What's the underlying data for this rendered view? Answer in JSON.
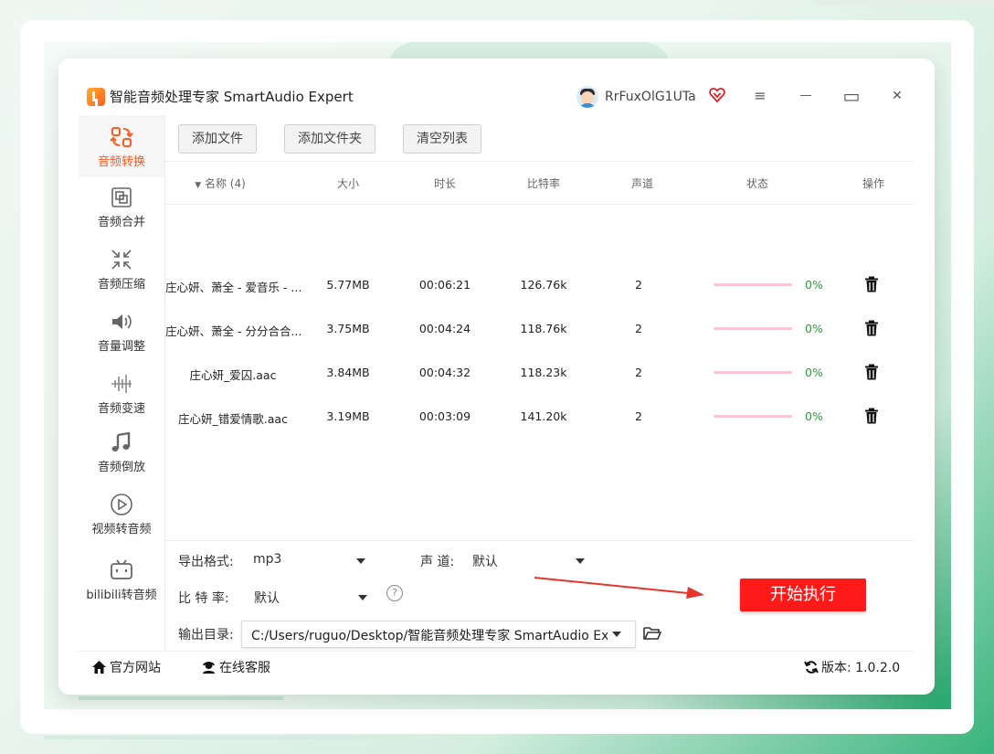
{
  "app": {
    "title": "智能音频处理专家 SmartAudio Expert",
    "user_name": "RrFuxOlG1UTa"
  },
  "window_controls": {
    "menu": "≡",
    "minimize": "—",
    "maximize": "▭",
    "close": "✕"
  },
  "sidebar": {
    "items": [
      {
        "label": "音频转换",
        "icon": "audio-convert-icon",
        "active": true
      },
      {
        "label": "音频合并",
        "icon": "audio-merge-icon"
      },
      {
        "label": "音频压缩",
        "icon": "audio-compress-icon"
      },
      {
        "label": "音量调整",
        "icon": "volume-icon"
      },
      {
        "label": "音频变速",
        "icon": "speed-icon"
      },
      {
        "label": "音频倒放",
        "icon": "music-note-icon"
      },
      {
        "label": "视频转音频",
        "icon": "video-play-icon"
      },
      {
        "label": "bilibili转音频",
        "icon": "bilibili-icon"
      }
    ]
  },
  "toolbar": {
    "add_file": "添加文件",
    "add_folder": "添加文件夹",
    "clear_list": "清空列表"
  },
  "table": {
    "headers": {
      "name": "名称 (4)",
      "size": "大小",
      "duration": "时长",
      "bitrate": "比特率",
      "channels": "声道",
      "status": "状态",
      "actions": "操作"
    },
    "rows": [
      {
        "name": "庄心妍、萧全 - 爱音乐 - ...",
        "size": "5.77MB",
        "duration": "00:06:21",
        "bitrate": "126.76k",
        "channels": "2",
        "progress": "0%"
      },
      {
        "name": "庄心妍、萧全 - 分分合合....",
        "size": "3.75MB",
        "duration": "00:04:24",
        "bitrate": "118.76k",
        "channels": "2",
        "progress": "0%"
      },
      {
        "name": "庄心妍_爱囚.aac",
        "size": "3.84MB",
        "duration": "00:04:32",
        "bitrate": "118.23k",
        "channels": "2",
        "progress": "0%"
      },
      {
        "name": "庄心妍_错爱情歌.aac",
        "size": "3.19MB",
        "duration": "00:03:09",
        "bitrate": "141.20k",
        "channels": "2",
        "progress": "0%"
      }
    ]
  },
  "settings": {
    "format_label": "导出格式:",
    "format_value": "mp3",
    "channel_label": "声 道:",
    "channel_value": "默认",
    "bitrate_label": "比 特 率:",
    "bitrate_value": "默认",
    "help": "?",
    "output_label": "输出目录:",
    "output_value": "C:/Users/ruguo/Desktop/智能音频处理专家 SmartAudio Expert",
    "start_button": "开始执行"
  },
  "footer": {
    "website": "官方网站",
    "support": "在线客服",
    "version_label": "版本:",
    "version_value": "1.0.2.0"
  },
  "colors": {
    "accent": "#ff5a1f",
    "start_button": "#ff1a1a",
    "progress_track": "#f9c7d3",
    "percent_text": "#2a9d3a",
    "arrow": "#e8342a"
  }
}
